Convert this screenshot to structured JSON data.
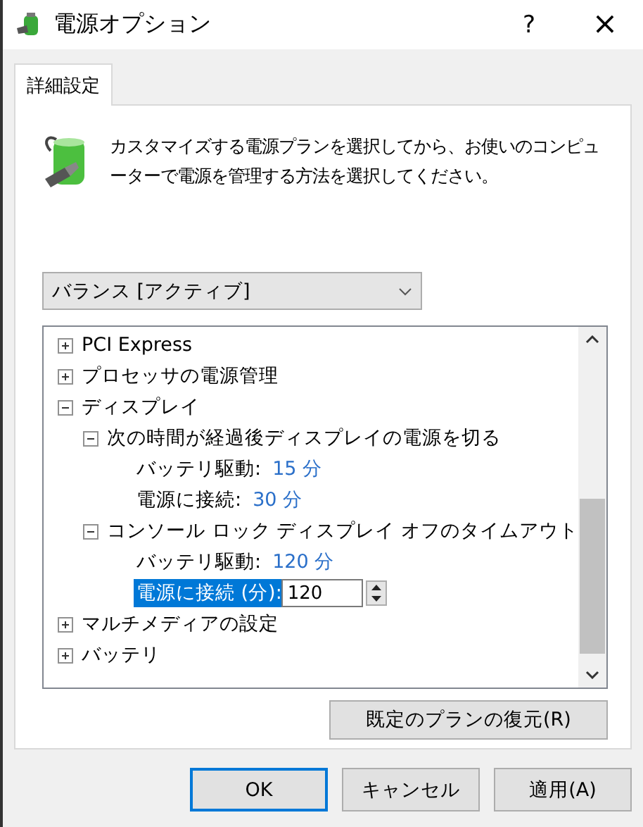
{
  "window": {
    "title": "電源オプション",
    "help": "?",
    "close": "×"
  },
  "tabs": [
    {
      "label": "詳細設定",
      "selected": true
    }
  ],
  "description": "カスタマイズする電源プランを選択してから、お使いのコンピューターで電源を管理する方法を選択してください。",
  "plan_dropdown": {
    "value": "バランス [アクティブ]"
  },
  "tree": [
    {
      "label": "PCI Express",
      "expanded": false
    },
    {
      "label": "プロセッサの電源管理",
      "expanded": false
    },
    {
      "label": "ディスプレイ",
      "expanded": true,
      "children": [
        {
          "label": "次の時間が経過後ディスプレイの電源を切る",
          "expanded": true,
          "children": [
            {
              "kind": "setting",
              "label": "バッテリ駆動:",
              "value": "15 分"
            },
            {
              "kind": "setting",
              "label": "電源に接続:",
              "value": "30 分"
            }
          ]
        },
        {
          "label": "コンソール ロック ディスプレイ オフのタイムアウト",
          "expanded": true,
          "children": [
            {
              "kind": "setting",
              "label": "バッテリ駆動:",
              "value": "120 分"
            },
            {
              "kind": "spin",
              "label": "電源に接続 (分):",
              "value": "120",
              "selected": true
            }
          ]
        }
      ]
    },
    {
      "label": "マルチメディアの設定",
      "expanded": false
    },
    {
      "label": "バッテリ",
      "expanded": false
    }
  ],
  "restore_button": "既定のプランの復元(R)",
  "buttons": [
    {
      "label": "OK",
      "default": true
    },
    {
      "label": "キャンセル",
      "default": false
    },
    {
      "label": "適用(A)",
      "default": false
    }
  ]
}
